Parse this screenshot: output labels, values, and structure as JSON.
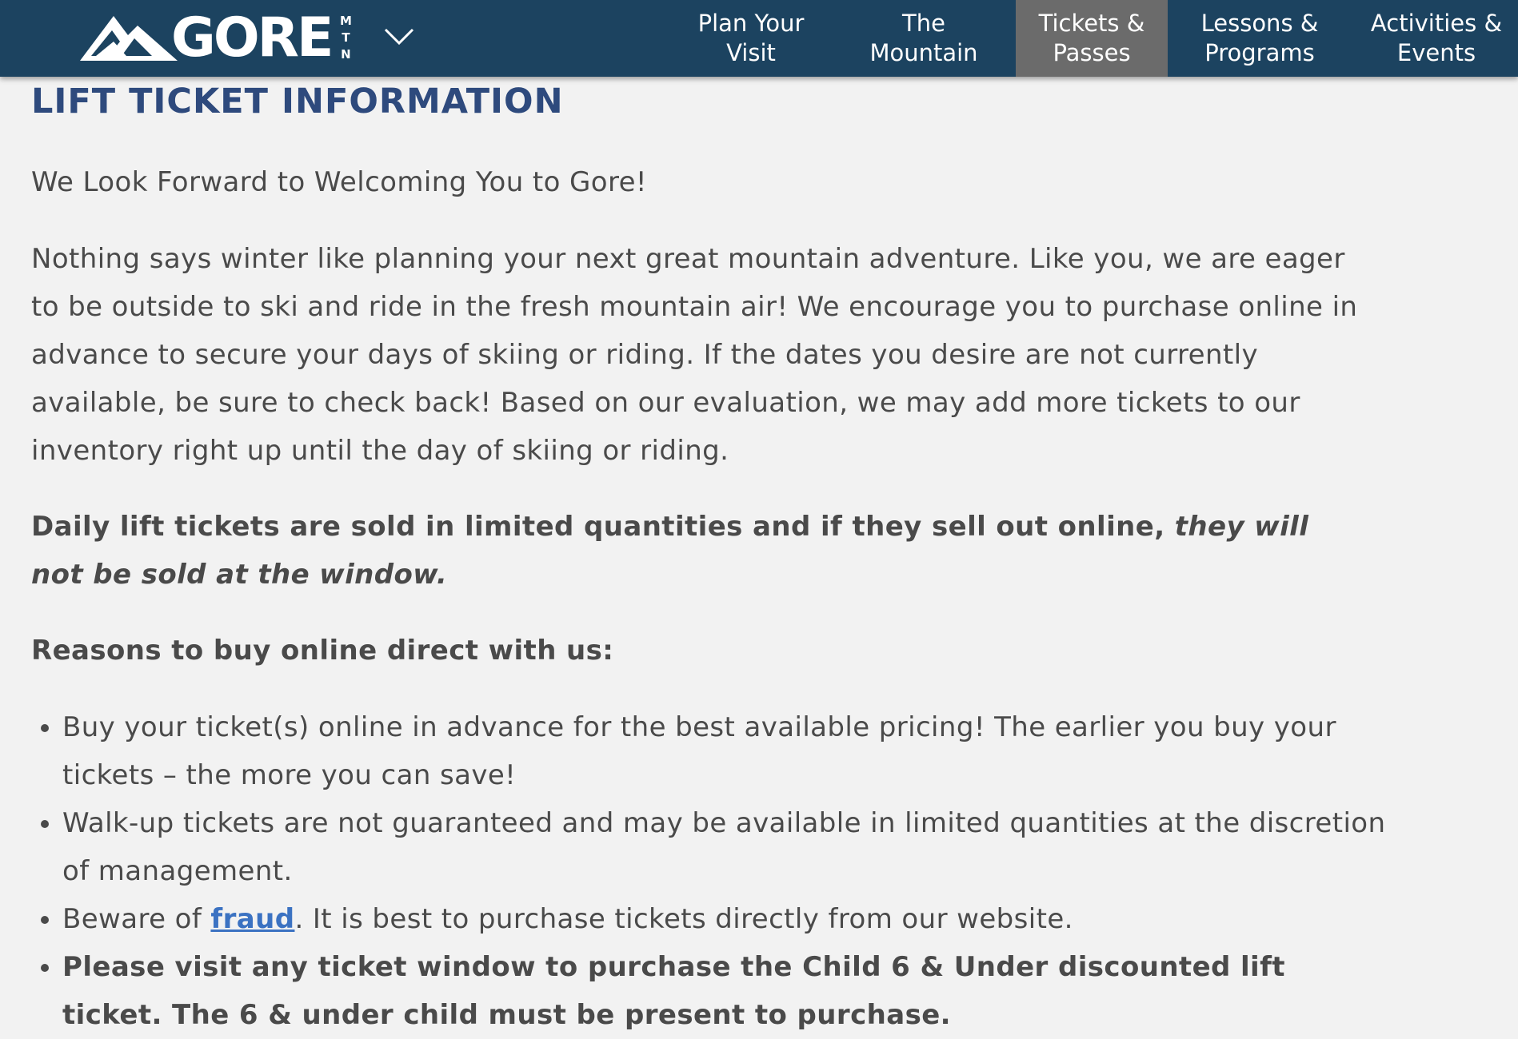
{
  "brand": {
    "name": "GORE",
    "sub": "MTN",
    "logo": "mountain-logo-icon",
    "colors": {
      "nav_bg": "#1c4360",
      "nav_active": "#6b6b6b",
      "heading": "#2e4a7d",
      "link": "#3b72c2",
      "body_text": "#4a4a4a"
    }
  },
  "nav": {
    "menu_icon": "chevron-down-icon",
    "items": [
      {
        "label": "Plan Your\nVisit"
      },
      {
        "label": "The\nMountain"
      },
      {
        "label": "Tickets &\nPasses",
        "active": true
      },
      {
        "label": "Lessons &\nPrograms"
      },
      {
        "label": "Activities &\nEvents"
      }
    ]
  },
  "content": {
    "heading": "LIFT TICKET INFORMATION",
    "welcome": "We Look Forward to Welcoming You to Gore!",
    "intro": "Nothing says winter like planning your next great mountain adventure. Like you, we are eager to be outside to ski and ride in the fresh mountain air! We encourage you to purchase online in advance to secure your days of skiing or riding. If the dates you desire are not currently available, be sure to check back! Based on our evaluation, we may add more tickets to our inventory right up until the day of skiing or riding.",
    "notice_bold": "Daily lift tickets are sold in limited quantities and if they sell out online, ",
    "notice_italic": "they will not be sold at the window.",
    "reasons_heading": "Reasons to buy online direct with us:",
    "reasons": {
      "r1": "Buy your ticket(s) online in advance for the best available pricing! The earlier you buy your tickets – the more you can save!",
      "r2": "Walk-up tickets are not guaranteed and may be available in limited quantities at the discretion of management.",
      "r3_before": "Beware of ",
      "r3_link": "fraud",
      "r3_after": ". It is best to purchase tickets directly from our website.",
      "r4": "Please visit any ticket window to purchase the Child 6 & Under discounted lift ticket. The 6 & under child must be present to purchase."
    }
  }
}
